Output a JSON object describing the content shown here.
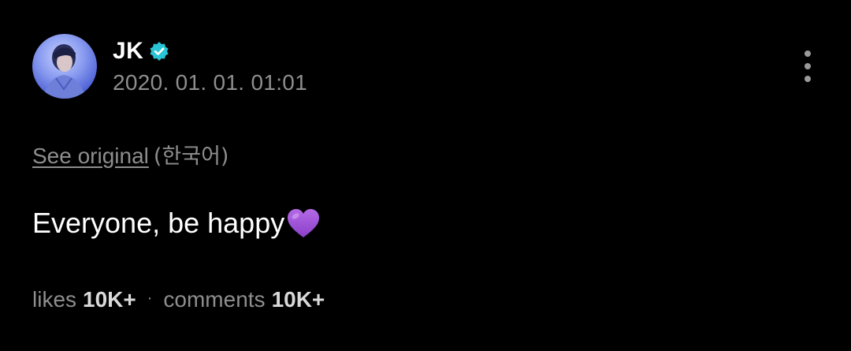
{
  "author": {
    "name": "JK",
    "verified": true,
    "badge_color": "#29c5d6"
  },
  "post": {
    "timestamp": "2020. 01. 01. 01:01",
    "translation": {
      "see_original_label": "See original",
      "language": "(한국어)"
    },
    "body_text": "Everyone, be happy",
    "body_emoji": "purple-heart",
    "stats": {
      "likes_label": "likes",
      "likes_value": "10K+",
      "separator": "·",
      "comments_label": "comments",
      "comments_value": "10K+"
    }
  },
  "colors": {
    "background": "#000000",
    "primary_text": "#ffffff",
    "secondary_text": "#8e8e8e",
    "heart": "#9b4fd6"
  },
  "icons": {
    "more": "more-vertical-icon",
    "verified": "verified-badge-icon",
    "emoji": "purple-heart-icon"
  }
}
